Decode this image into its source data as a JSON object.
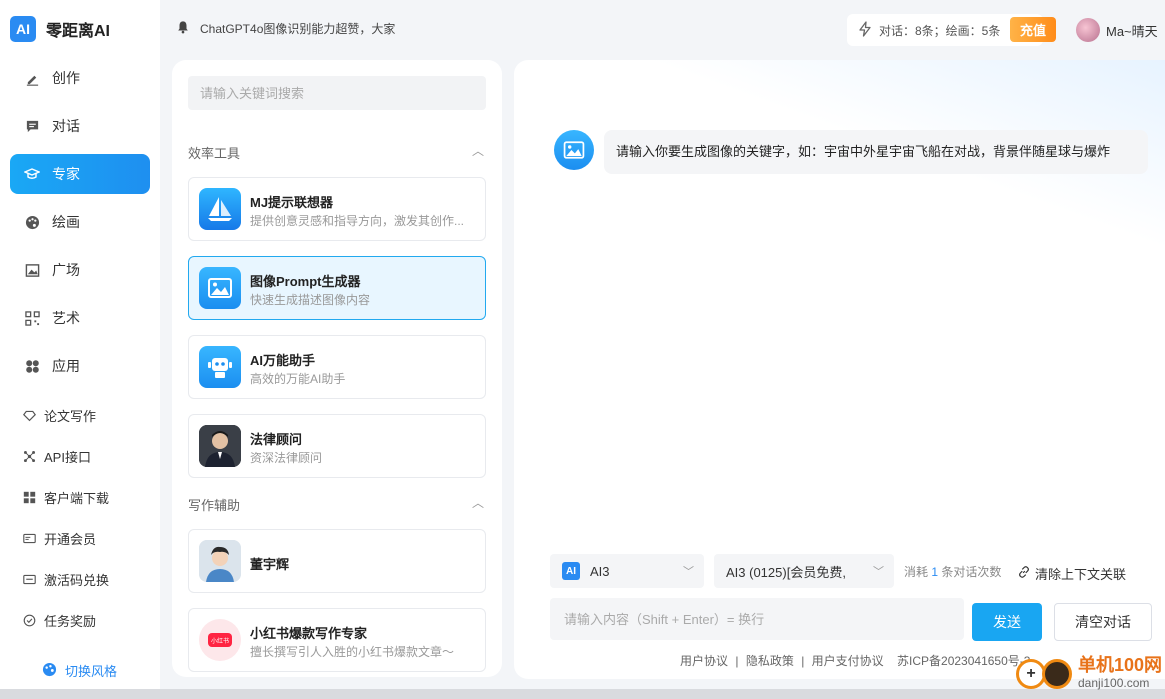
{
  "app": {
    "logo_badge": "AI",
    "name": "零距离AI"
  },
  "sidebar": {
    "main_items": [
      {
        "label": "创作",
        "icon": "pen-icon"
      },
      {
        "label": "对话",
        "icon": "chat-icon"
      },
      {
        "label": "专家",
        "icon": "graduation-cap-icon",
        "active": true
      },
      {
        "label": "绘画",
        "icon": "palette-icon"
      },
      {
        "label": "广场",
        "icon": "image-icon"
      },
      {
        "label": "艺术",
        "icon": "qrcode-icon"
      },
      {
        "label": "应用",
        "icon": "apps-icon"
      }
    ],
    "extra_items": [
      {
        "label": "论文写作",
        "icon": "diamond-icon"
      },
      {
        "label": "API接口",
        "icon": "api-icon"
      },
      {
        "label": "客户端下载",
        "icon": "windows-icon"
      },
      {
        "label": "开通会员",
        "icon": "vip-card-icon"
      },
      {
        "label": "激活码兑换",
        "icon": "ticket-icon"
      },
      {
        "label": "任务奖励",
        "icon": "gift-icon"
      }
    ],
    "switch_style": "切换风格"
  },
  "topbar": {
    "notice": "ChatGPT4o图像识别能力超赞，大家",
    "stats": "对话：8条；绘画：5条",
    "recharge": "充值",
    "user_name": "Ma~晴天"
  },
  "experts": {
    "search_placeholder": "请输入关键词搜索",
    "sections": [
      {
        "title": "效率工具"
      },
      {
        "title": "写作辅助"
      }
    ],
    "cards": [
      {
        "name": "MJ提示联想器",
        "desc": "提供创意灵感和指导方向，激发其创作..."
      },
      {
        "name": "图像Prompt生成器",
        "desc": "快速生成描述图像内容",
        "active": true
      },
      {
        "name": "AI万能助手",
        "desc": "高效的万能AI助手"
      },
      {
        "name": "法律顾问",
        "desc": "资深法律顾问"
      },
      {
        "name": "董宇辉",
        "desc": ""
      },
      {
        "name": "小红书爆款写作专家",
        "desc": "擅长撰写引人入胜的小红书爆款文章～"
      }
    ]
  },
  "chat": {
    "message": "请输入你要生成图像的关键字，如：宇宙中外星宇宙飞船在对战，背景伴随星球与爆炸",
    "model_select": "AI3",
    "model_variant": "AI3 (0125)[会员免费,",
    "consume_prefix": "消耗",
    "consume_num": "1",
    "consume_suffix": "条对话次数",
    "clear_context": "清除上下文关联",
    "input_placeholder": "请输入内容（Shift + Enter）= 换行",
    "send": "发送",
    "clear_chat": "清空对话",
    "footer": {
      "agreement": "用户协议",
      "privacy": "隐私政策",
      "payment": "用户支付协议",
      "sep": "|",
      "icp": "苏ICP备2023041650号-3"
    }
  },
  "watermark": {
    "line1": "单机100网",
    "line2": "danji100.com"
  },
  "colors": {
    "accent": "#1aa8f5",
    "recharge": "#ff9a2e",
    "active_card_bg": "#e8f6ff"
  }
}
